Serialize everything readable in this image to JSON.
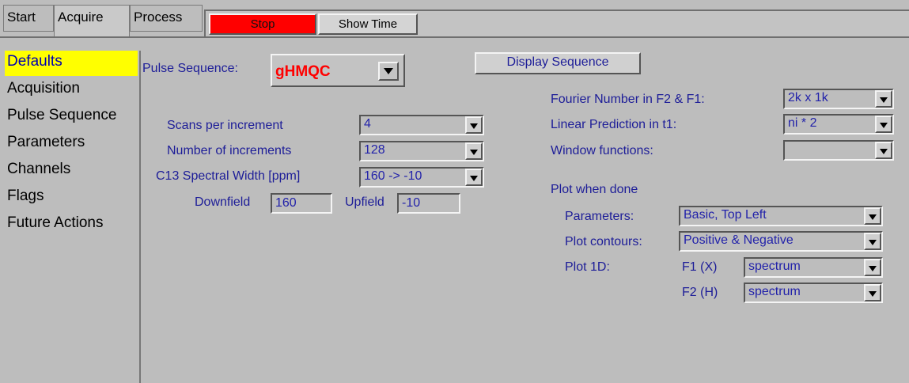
{
  "tabs": {
    "start": "Start",
    "acquire": "Acquire",
    "process": "Process"
  },
  "toolbar": {
    "stop_label": "Stop",
    "show_time_label": "Show Time"
  },
  "sidebar": {
    "items": [
      "Defaults",
      "Acquisition",
      "Pulse Sequence",
      "Parameters",
      "Channels",
      "Flags",
      "Future Actions"
    ],
    "selected": "Defaults"
  },
  "pulse": {
    "label": "Pulse Sequence:",
    "value": "gHMQC",
    "display_button": "Display Sequence"
  },
  "acq": {
    "scans_label": "Scans per increment",
    "scans_value": "4",
    "incr_label": "Number of increments",
    "incr_value": "128",
    "sw_label": "C13 Spectral Width [ppm]",
    "sw_value": "160 -> -10",
    "downfield_label": "Downfield",
    "downfield_value": "160",
    "upfield_label": "Upfield",
    "upfield_value": "-10"
  },
  "proc": {
    "fourier_label": "Fourier Number in F2 & F1:",
    "fourier_value": "2k x 1k",
    "lp_label": "Linear Prediction in t1:",
    "lp_value": "ni * 2",
    "wf_label": "Window functions:",
    "wf_value": ""
  },
  "plot": {
    "heading": "Plot when done",
    "params_label": "Parameters:",
    "params_value": "Basic, Top Left",
    "contours_label": "Plot contours:",
    "contours_value": "Positive & Negative",
    "plot1d_label": "Plot 1D:",
    "f1_label": "F1 (X)",
    "f1_value": "spectrum",
    "f2_label": "F2 (H)",
    "f2_value": "spectrum"
  },
  "colors": {
    "accent_selected": "#ffff00",
    "stop": "#ff0000",
    "label_text": "#1d1d98",
    "sequence_text": "#ff0000"
  }
}
